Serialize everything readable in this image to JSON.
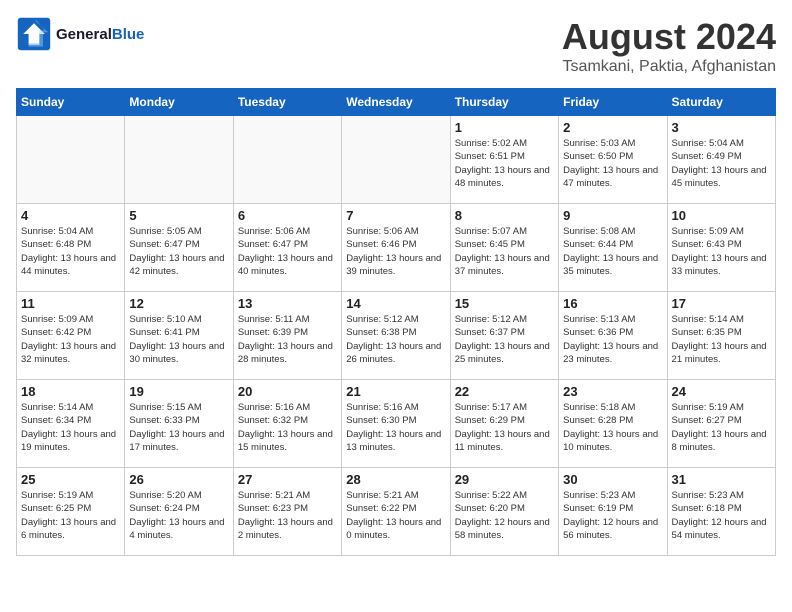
{
  "logo": {
    "line1": "General",
    "line2": "Blue"
  },
  "title": "August 2024",
  "subtitle": "Tsamkani, Paktia, Afghanistan",
  "days_of_week": [
    "Sunday",
    "Monday",
    "Tuesday",
    "Wednesday",
    "Thursday",
    "Friday",
    "Saturday"
  ],
  "weeks": [
    [
      {
        "day": "",
        "empty": true
      },
      {
        "day": "",
        "empty": true
      },
      {
        "day": "",
        "empty": true
      },
      {
        "day": "",
        "empty": true
      },
      {
        "day": "1",
        "sunrise": "5:02 AM",
        "sunset": "6:51 PM",
        "daylight": "13 hours and 48 minutes."
      },
      {
        "day": "2",
        "sunrise": "5:03 AM",
        "sunset": "6:50 PM",
        "daylight": "13 hours and 47 minutes."
      },
      {
        "day": "3",
        "sunrise": "5:04 AM",
        "sunset": "6:49 PM",
        "daylight": "13 hours and 45 minutes."
      }
    ],
    [
      {
        "day": "4",
        "sunrise": "5:04 AM",
        "sunset": "6:48 PM",
        "daylight": "13 hours and 44 minutes."
      },
      {
        "day": "5",
        "sunrise": "5:05 AM",
        "sunset": "6:47 PM",
        "daylight": "13 hours and 42 minutes."
      },
      {
        "day": "6",
        "sunrise": "5:06 AM",
        "sunset": "6:47 PM",
        "daylight": "13 hours and 40 minutes."
      },
      {
        "day": "7",
        "sunrise": "5:06 AM",
        "sunset": "6:46 PM",
        "daylight": "13 hours and 39 minutes."
      },
      {
        "day": "8",
        "sunrise": "5:07 AM",
        "sunset": "6:45 PM",
        "daylight": "13 hours and 37 minutes."
      },
      {
        "day": "9",
        "sunrise": "5:08 AM",
        "sunset": "6:44 PM",
        "daylight": "13 hours and 35 minutes."
      },
      {
        "day": "10",
        "sunrise": "5:09 AM",
        "sunset": "6:43 PM",
        "daylight": "13 hours and 33 minutes."
      }
    ],
    [
      {
        "day": "11",
        "sunrise": "5:09 AM",
        "sunset": "6:42 PM",
        "daylight": "13 hours and 32 minutes."
      },
      {
        "day": "12",
        "sunrise": "5:10 AM",
        "sunset": "6:41 PM",
        "daylight": "13 hours and 30 minutes."
      },
      {
        "day": "13",
        "sunrise": "5:11 AM",
        "sunset": "6:39 PM",
        "daylight": "13 hours and 28 minutes."
      },
      {
        "day": "14",
        "sunrise": "5:12 AM",
        "sunset": "6:38 PM",
        "daylight": "13 hours and 26 minutes."
      },
      {
        "day": "15",
        "sunrise": "5:12 AM",
        "sunset": "6:37 PM",
        "daylight": "13 hours and 25 minutes."
      },
      {
        "day": "16",
        "sunrise": "5:13 AM",
        "sunset": "6:36 PM",
        "daylight": "13 hours and 23 minutes."
      },
      {
        "day": "17",
        "sunrise": "5:14 AM",
        "sunset": "6:35 PM",
        "daylight": "13 hours and 21 minutes."
      }
    ],
    [
      {
        "day": "18",
        "sunrise": "5:14 AM",
        "sunset": "6:34 PM",
        "daylight": "13 hours and 19 minutes."
      },
      {
        "day": "19",
        "sunrise": "5:15 AM",
        "sunset": "6:33 PM",
        "daylight": "13 hours and 17 minutes."
      },
      {
        "day": "20",
        "sunrise": "5:16 AM",
        "sunset": "6:32 PM",
        "daylight": "13 hours and 15 minutes."
      },
      {
        "day": "21",
        "sunrise": "5:16 AM",
        "sunset": "6:30 PM",
        "daylight": "13 hours and 13 minutes."
      },
      {
        "day": "22",
        "sunrise": "5:17 AM",
        "sunset": "6:29 PM",
        "daylight": "13 hours and 11 minutes."
      },
      {
        "day": "23",
        "sunrise": "5:18 AM",
        "sunset": "6:28 PM",
        "daylight": "13 hours and 10 minutes."
      },
      {
        "day": "24",
        "sunrise": "5:19 AM",
        "sunset": "6:27 PM",
        "daylight": "13 hours and 8 minutes."
      }
    ],
    [
      {
        "day": "25",
        "sunrise": "5:19 AM",
        "sunset": "6:25 PM",
        "daylight": "13 hours and 6 minutes."
      },
      {
        "day": "26",
        "sunrise": "5:20 AM",
        "sunset": "6:24 PM",
        "daylight": "13 hours and 4 minutes."
      },
      {
        "day": "27",
        "sunrise": "5:21 AM",
        "sunset": "6:23 PM",
        "daylight": "13 hours and 2 minutes."
      },
      {
        "day": "28",
        "sunrise": "5:21 AM",
        "sunset": "6:22 PM",
        "daylight": "13 hours and 0 minutes."
      },
      {
        "day": "29",
        "sunrise": "5:22 AM",
        "sunset": "6:20 PM",
        "daylight": "12 hours and 58 minutes."
      },
      {
        "day": "30",
        "sunrise": "5:23 AM",
        "sunset": "6:19 PM",
        "daylight": "12 hours and 56 minutes."
      },
      {
        "day": "31",
        "sunrise": "5:23 AM",
        "sunset": "6:18 PM",
        "daylight": "12 hours and 54 minutes."
      }
    ]
  ],
  "labels": {
    "sunrise": "Sunrise:",
    "sunset": "Sunset:",
    "daylight": "Daylight:"
  }
}
